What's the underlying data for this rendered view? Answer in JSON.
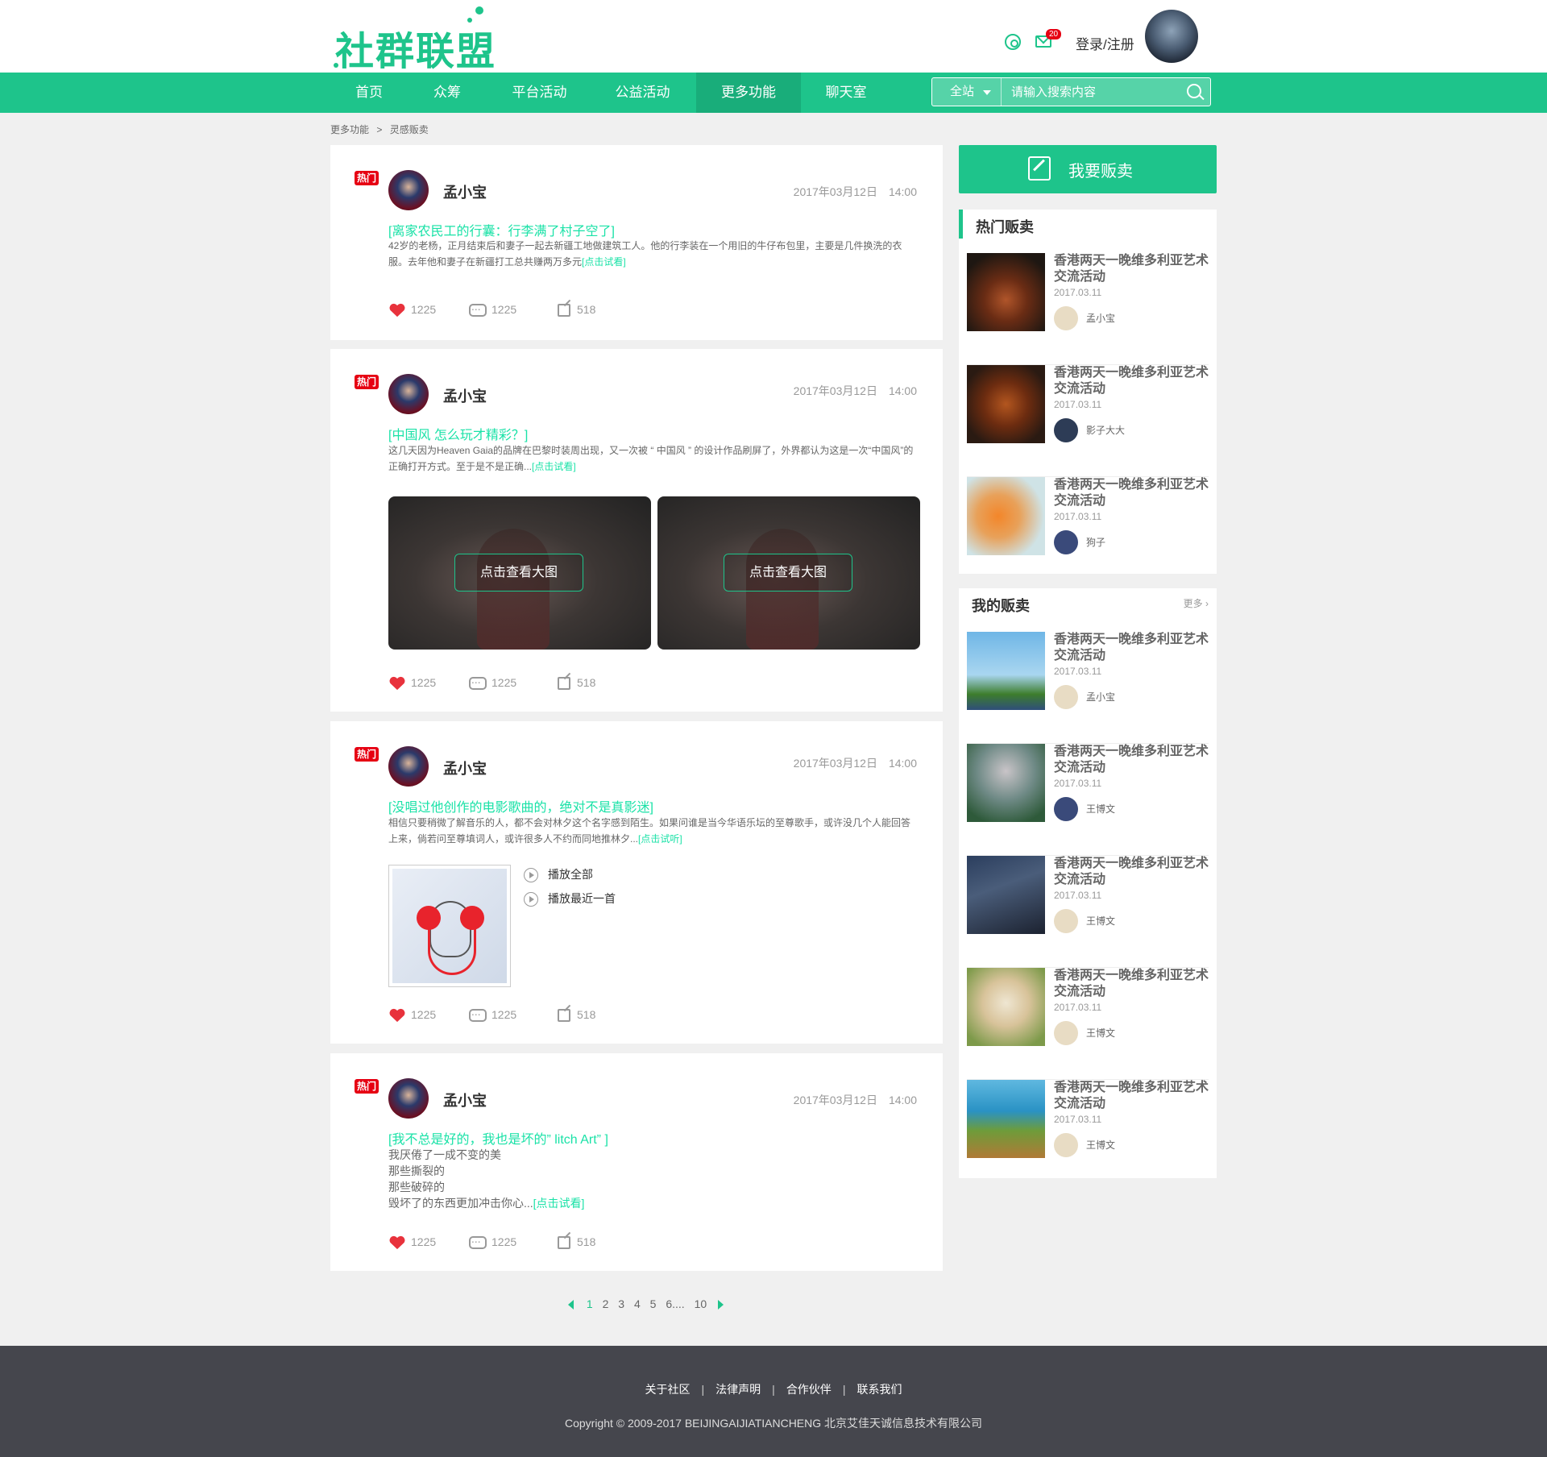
{
  "header": {
    "logo_text": "社群联盟",
    "mail_badge": "20",
    "login_label": "登录/注册"
  },
  "nav": {
    "items": [
      "首页",
      "众筹",
      "平台活动",
      "公益活动",
      "更多功能",
      "聊天室"
    ],
    "active_index": 4,
    "search_scope": "全站",
    "search_placeholder": "请输入搜索内容"
  },
  "breadcrumb": [
    "更多功能",
    ">",
    "灵感贩卖"
  ],
  "posts": [
    {
      "hot": "热门",
      "author": "孟小宝",
      "date": "2017年03月12日",
      "time": "14:00",
      "title": "[离家农民工的行囊：行李满了村子空了]",
      "body": "42岁的老杨，正月结束后和妻子一起去新疆工地做建筑工人。他的行李装在一个用旧的牛仔布包里，主要是几件换洗的衣服。去年他和妻子在新疆打工总共赚两万多元",
      "more": "[点击试看]",
      "likes": "1225",
      "comments": "1225",
      "shares": "518"
    },
    {
      "hot": "热门",
      "author": "孟小宝",
      "date": "2017年03月12日",
      "time": "14:00",
      "title": "[中国风  怎么玩才精彩？]",
      "body": "这几天因为Heaven Gaia的品牌在巴黎时装周出现，又一次被 “ 中国风 ” 的设计作品刷屏了，外界都认为这是一次“中国风”的正确打开方式。至于是不是正确...",
      "more": "[点击试看]",
      "view_button": "点击查看大图",
      "likes": "1225",
      "comments": "1225",
      "shares": "518"
    },
    {
      "hot": "热门",
      "author": "孟小宝",
      "date": "2017年03月12日",
      "time": "14:00",
      "title": "[没唱过他创作的电影歌曲的，绝对不是真影迷]",
      "body": "相信只要稍微了解音乐的人，都不会对林夕这个名字感到陌生。如果问谁是当今华语乐坛的至尊歌手，或许没几个人能回答上来，倘若问至尊填词人，或许很多人不约而同地推林夕...",
      "more": "[点击试听]",
      "play_all": "播放全部",
      "play_recent": "播放最近一首",
      "likes": "1225",
      "comments": "1225",
      "shares": "518"
    },
    {
      "hot": "热门",
      "author": "孟小宝",
      "date": "2017年03月12日",
      "time": "14:00",
      "title": "[我不总是好的，我也是坏的” litch Art” ]",
      "lines": [
        "我厌倦了一成不变的美",
        "那些撕裂的",
        "那些破碎的",
        "毁坏了的东西更加冲击你心..."
      ],
      "more": "[点击试看]",
      "likes": "1225",
      "comments": "1225",
      "shares": "518"
    }
  ],
  "pagination": [
    "1",
    "2",
    "3",
    "4",
    "5",
    "6....",
    "10"
  ],
  "sidebar": {
    "sell_button": "我要贩卖",
    "hot_title": "热门贩卖",
    "hot_items": [
      {
        "title": "香港两天一晚维多利亚艺术交流活动",
        "date": "2017.03.11",
        "user": "孟小宝"
      },
      {
        "title": "香港两天一晚维多利亚艺术交流活动",
        "date": "2017.03.11",
        "user": "影子大大"
      },
      {
        "title": "香港两天一晚维多利亚艺术交流活动",
        "date": "2017.03.11",
        "user": "狗子"
      }
    ],
    "mine_title": "我的贩卖",
    "mine_more": "更多 ›",
    "mine_items": [
      {
        "title": "香港两天一晚维多利亚艺术交流活动",
        "date": "2017.03.11",
        "user": "孟小宝"
      },
      {
        "title": "香港两天一晚维多利亚艺术交流活动",
        "date": "2017.03.11",
        "user": "王博文"
      },
      {
        "title": "香港两天一晚维多利亚艺术交流活动",
        "date": "2017.03.11",
        "user": "王博文"
      },
      {
        "title": "香港两天一晚维多利亚艺术交流活动",
        "date": "2017.03.11",
        "user": "王博文"
      },
      {
        "title": "香港两天一晚维多利亚艺术交流活动",
        "date": "2017.03.11",
        "user": "王博文"
      }
    ]
  },
  "footer": {
    "links": [
      "关于社区",
      "法律声明",
      "合作伙伴",
      "联系我们"
    ],
    "separator": "|",
    "copyright": "Copyright © 2009-2017 BEIJINGAIJIATIANCHENG 北京艾佳天诚信息技术有限公司"
  },
  "colors": {
    "accent": "#1ec48b",
    "title_green": "#1ae2a7",
    "hot_red": "#e60012",
    "text_dark": "#333333",
    "text_gray": "#666666",
    "text_light": "#999999"
  }
}
